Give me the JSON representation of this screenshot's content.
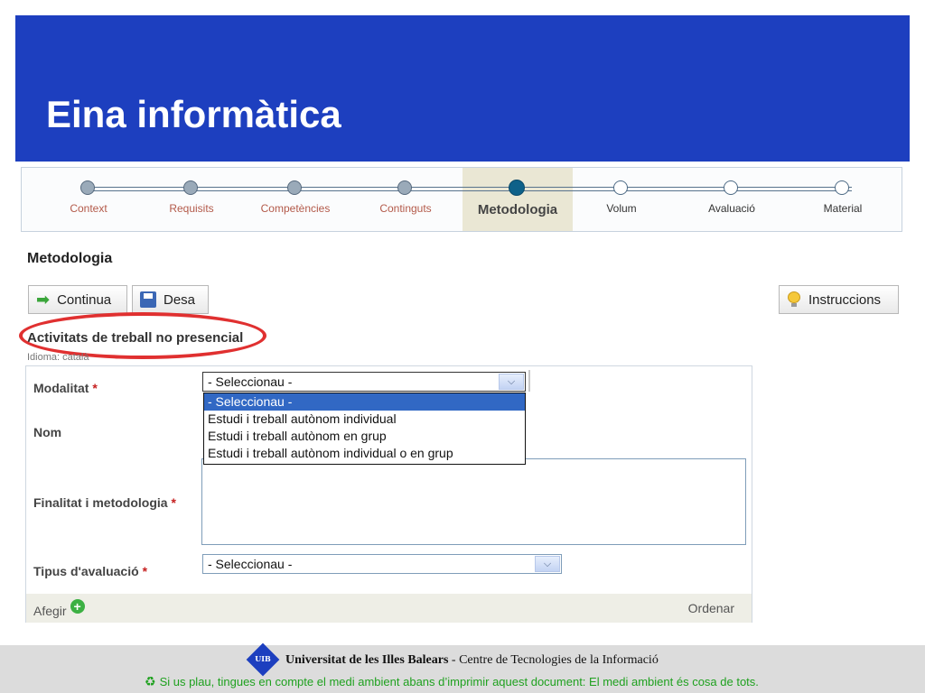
{
  "header": {
    "title": "Eina informàtica",
    "bg_color": "#1d3fbf"
  },
  "stepper": {
    "steps": [
      {
        "label": "Context",
        "state": "done"
      },
      {
        "label": "Requisits",
        "state": "done"
      },
      {
        "label": "Competències",
        "state": "done"
      },
      {
        "label": "Continguts",
        "state": "done"
      },
      {
        "label": "Metodologia",
        "state": "current"
      },
      {
        "label": "Volum",
        "state": "todo"
      },
      {
        "label": "Avaluació",
        "state": "todo"
      },
      {
        "label": "Material",
        "state": "todo"
      }
    ]
  },
  "page": {
    "section_title": "Metodologia"
  },
  "toolbar": {
    "continue_label": "Continua",
    "save_label": "Desa",
    "instructions_label": "Instruccions"
  },
  "form": {
    "subtitle": "Activitats de treball no presencial",
    "language_note": "Idioma: català",
    "modalitat": {
      "label": "Modalitat",
      "required_mark": "*",
      "selected": "- Seleccionau -",
      "options": [
        "- Seleccionau -",
        "Estudi i treball autònom individual",
        "Estudi i treball autònom en grup",
        "Estudi i treball autònom individual o en grup"
      ]
    },
    "nom": {
      "label": "Nom"
    },
    "finalitat": {
      "label": "Finalitat i metodologia",
      "required_mark": "*",
      "value": ""
    },
    "tipus": {
      "label": "Tipus d'avaluació",
      "required_mark": "*",
      "selected": "- Seleccionau -"
    },
    "add_label": "Afegir",
    "order_label": "Ordenar"
  },
  "footer": {
    "logo_text": "UIB",
    "university": "Universitat de les Illes Balears",
    "centre": "- Centre de Tecnologies de la Informació",
    "environment_note": "Si us plau, tingues en compte el medi ambient abans d’imprimir aquest document: El medi ambient és cosa de tots."
  }
}
